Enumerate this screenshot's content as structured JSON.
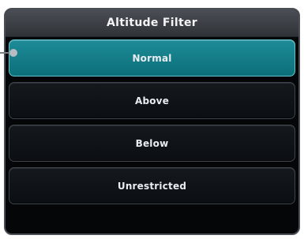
{
  "dialog": {
    "title": "Altitude Filter",
    "options": [
      {
        "label": "Normal",
        "selected": true
      },
      {
        "label": "Above",
        "selected": false
      },
      {
        "label": "Below",
        "selected": false
      },
      {
        "label": "Unrestricted",
        "selected": false
      }
    ]
  },
  "colors": {
    "selected_bg": "#0f7f89",
    "button_bg": "#0b0e12",
    "title_bg": "#3a3f45",
    "panel_bg": "#050608"
  }
}
